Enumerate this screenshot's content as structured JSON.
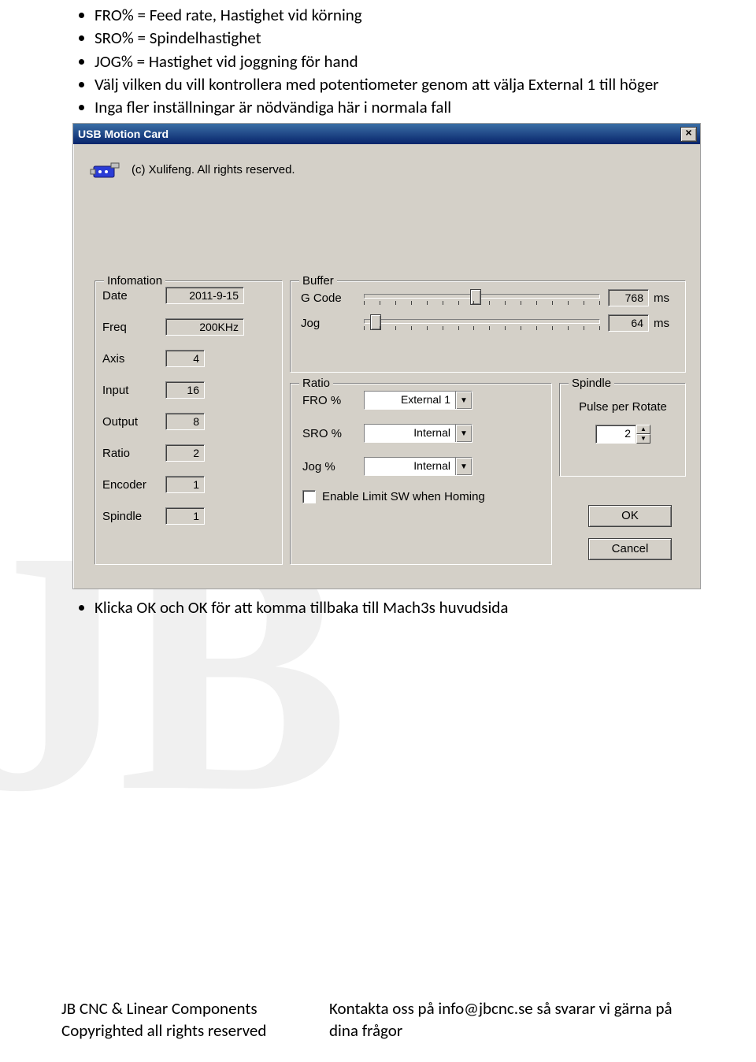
{
  "bullets_before": [
    "FRO% = Feed rate, Hastighet vid körning",
    "SRO% = Spindelhastighet",
    "JOG% = Hastighet vid joggning för hand",
    "Välj vilken du vill kontrollera med potentiometer genom att välja External 1 till höger",
    "Inga fler inställningar är nödvändiga här i normala fall"
  ],
  "bullets_after": [
    "Klicka OK och OK för att komma tillbaka till Mach3s huvudsida"
  ],
  "dialog": {
    "title": "USB Motion Card",
    "close": "×",
    "about": "(c) Xulifeng.  All rights reserved.",
    "groups": {
      "info": "Infomation",
      "buffer": "Buffer",
      "ratio": "Ratio",
      "spindle": "Spindle"
    },
    "info": {
      "date_lbl": "Date",
      "date": "2011-9-15",
      "freq_lbl": "Freq",
      "freq": "200KHz",
      "axis_lbl": "Axis",
      "axis": "4",
      "input_lbl": "Input",
      "input": "16",
      "output_lbl": "Output",
      "output": "8",
      "ratio_lbl": "Ratio",
      "ratio": "2",
      "encoder_lbl": "Encoder",
      "encoder": "1",
      "spindle_lbl": "Spindle",
      "spindle": "1"
    },
    "buffer": {
      "gcode_lbl": "G Code",
      "gcode_val": "768",
      "gcode_unit": "ms",
      "jog_lbl": "Jog",
      "jog_val": "64",
      "jog_unit": "ms"
    },
    "ratio": {
      "fro_lbl": "FRO %",
      "fro_val": "External 1",
      "sro_lbl": "SRO %",
      "sro_val": "Internal",
      "jog_lbl": "Jog %",
      "jog_val": "Internal",
      "enable_lbl": "Enable Limit SW when Homing"
    },
    "spindle": {
      "ppr_lbl": "Pulse per Rotate",
      "ppr_val": "2"
    },
    "ok": "OK",
    "cancel": "Cancel"
  },
  "footer": {
    "company": "JB CNC & Linear Components",
    "copyright": "Copyrighted all rights reserved",
    "contact": "Kontakta oss på info@jbcnc.se så svarar vi gärna på dina frågor"
  },
  "watermark": "JB"
}
